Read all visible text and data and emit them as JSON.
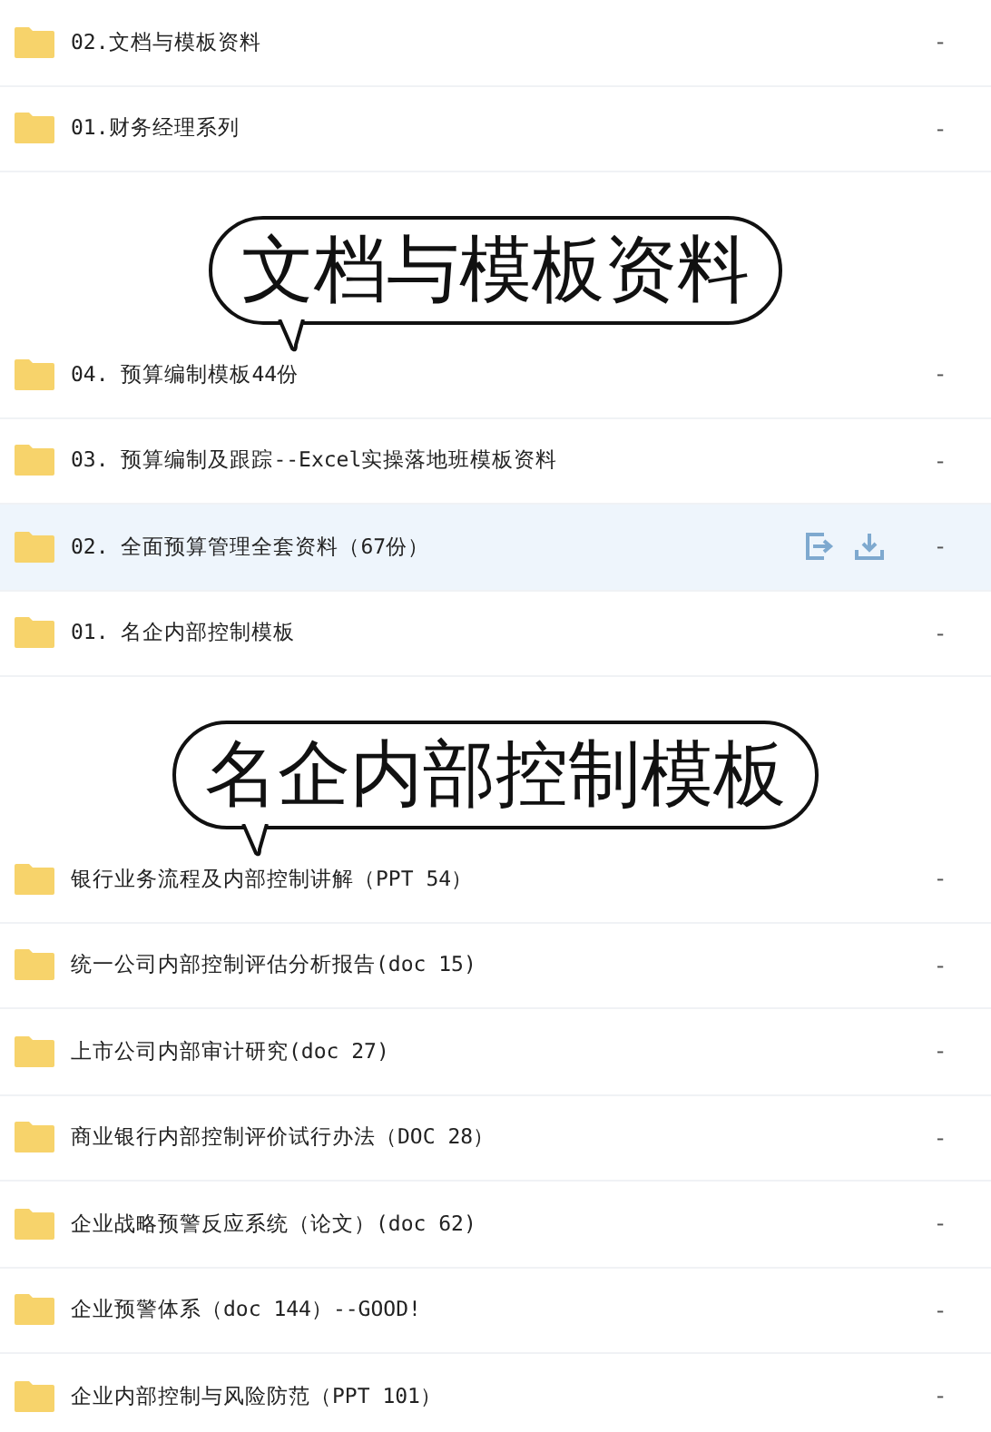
{
  "blocks": [
    {
      "kind": "files",
      "rows": [
        {
          "name": "02.文档与模板资料",
          "size": "-",
          "highlighted": false
        },
        {
          "name": "01.财务经理系列",
          "size": "-",
          "highlighted": false
        }
      ]
    },
    {
      "kind": "banner",
      "text": "文档与模板资料"
    },
    {
      "kind": "files",
      "rows": [
        {
          "name": "04. 预算编制模板44份",
          "size": "-",
          "highlighted": false
        },
        {
          "name": "03. 预算编制及跟踪--Excel实操落地班模板资料",
          "size": "-",
          "highlighted": false
        },
        {
          "name": "02. 全面预算管理全套资料（67份）",
          "size": "-",
          "highlighted": true
        },
        {
          "name": "01. 名企内部控制模板",
          "size": "-",
          "highlighted": false
        }
      ]
    },
    {
      "kind": "banner",
      "text": "名企内部控制模板"
    },
    {
      "kind": "files",
      "rows": [
        {
          "name": "银行业务流程及内部控制讲解（PPT 54）",
          "size": "-",
          "highlighted": false
        },
        {
          "name": "统一公司内部控制评估分析报告(doc 15)",
          "size": "-",
          "highlighted": false
        },
        {
          "name": "上市公司内部审计研究(doc 27)",
          "size": "-",
          "highlighted": false
        },
        {
          "name": "商业银行内部控制评价试行办法（DOC 28）",
          "size": "-",
          "highlighted": false
        },
        {
          "name": "企业战略预警反应系统（论文）(doc 62)",
          "size": "-",
          "highlighted": false
        },
        {
          "name": "企业预警体系（doc 144）--GOOD!",
          "size": "-",
          "highlighted": false
        },
        {
          "name": "企业内部控制与风险防范（PPT 101）",
          "size": "-",
          "highlighted": false
        }
      ]
    }
  ]
}
